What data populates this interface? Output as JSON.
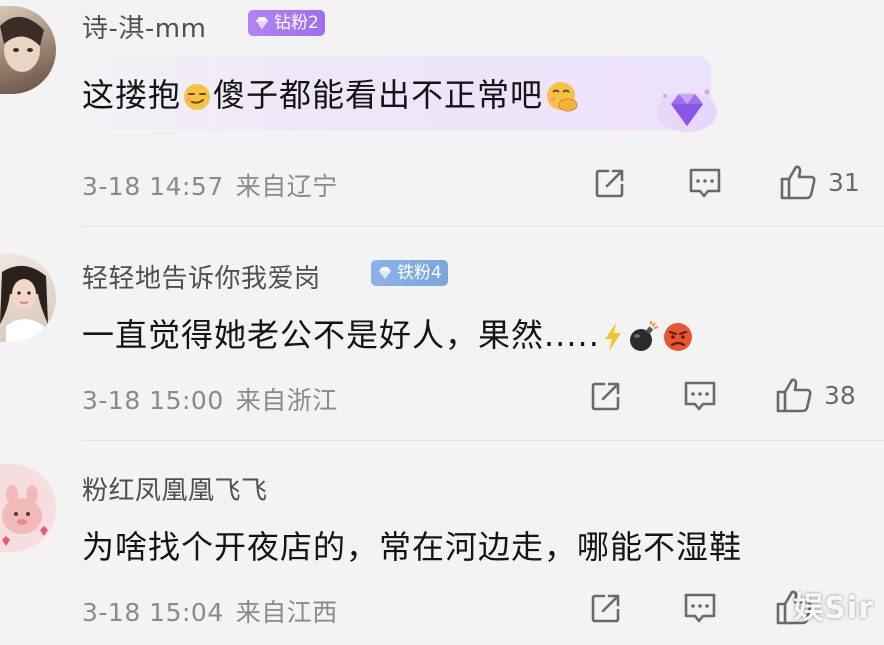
{
  "comments": [
    {
      "username": "诗-淇-mm",
      "badge": "钻粉2",
      "badge_type": "diamond",
      "content_parts": [
        "这搂抱",
        "傻子都能看出不正常吧"
      ],
      "emojis": [
        "smirk-face-emoji",
        "hand-over-mouth-emoji"
      ],
      "date": "3-18 14:57",
      "location": "来自辽宁",
      "likes": "31"
    },
    {
      "username": "轻轻地告诉你我爱岗",
      "badge": "铁粉4",
      "badge_type": "iron",
      "content_parts": [
        "一直觉得她老公不是好人，果然....."
      ],
      "emojis": [
        "lightning-emoji",
        "bomb-emoji",
        "angry-face-emoji"
      ],
      "date": "3-18 15:00",
      "location": "来自浙江",
      "likes": "38"
    },
    {
      "username": "粉红凤凰凰飞飞",
      "badge": "",
      "content_parts": [
        "为啥找个开夜店的，常在河边走，哪能不湿鞋"
      ],
      "emojis": [],
      "date": "3-18 15:04",
      "location": "来自江西",
      "likes": ""
    }
  ],
  "watermark": "娱Sir",
  "colors": {
    "background": "#f3f3f3",
    "text_primary": "#141414",
    "text_secondary": "#8a8a8a",
    "diamond_badge": "#a06ef0",
    "iron_badge": "#7aa5e0",
    "icon_gray": "#6a6a6a"
  },
  "icons": [
    "share-icon",
    "comment-icon",
    "like-icon"
  ]
}
